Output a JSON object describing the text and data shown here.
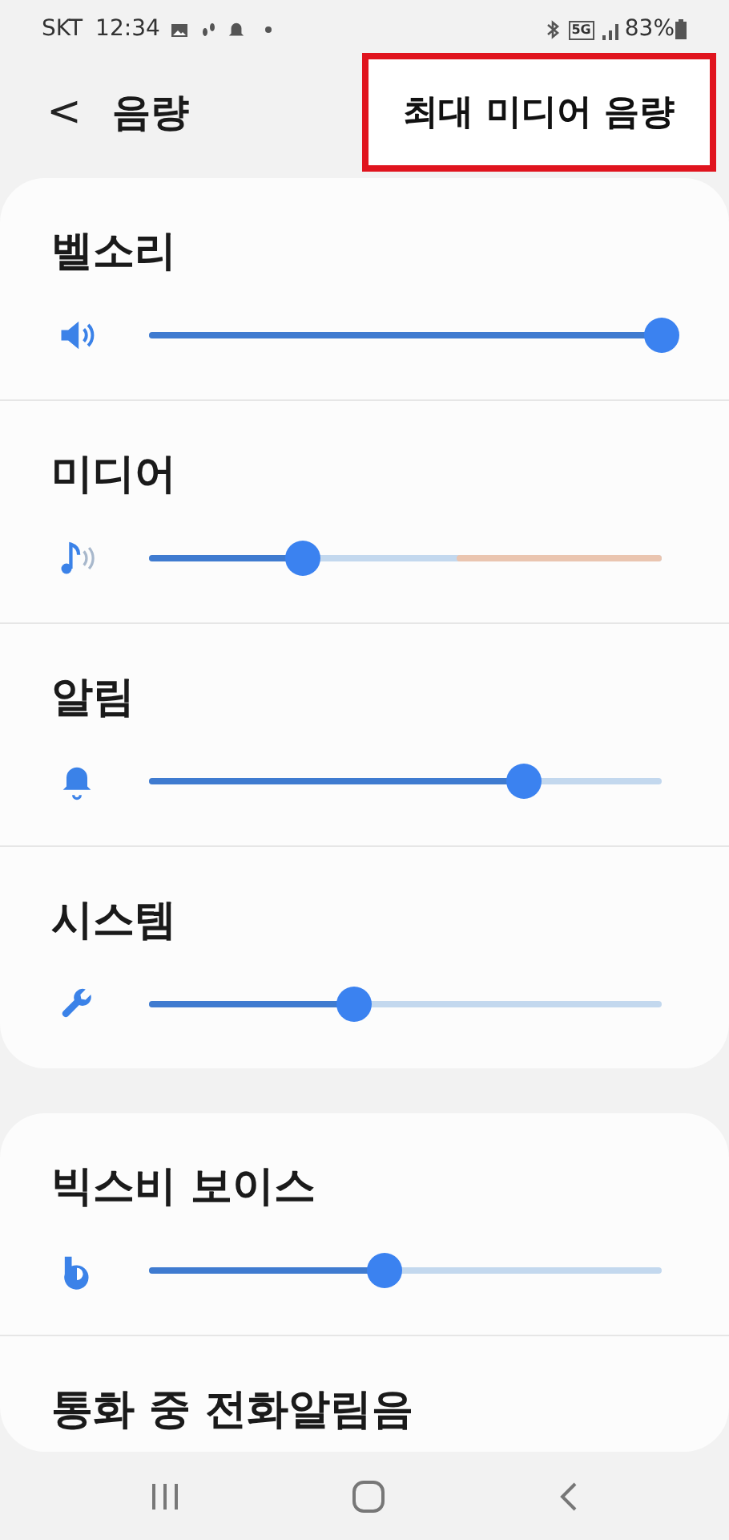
{
  "status_bar": {
    "carrier": "SKT",
    "time": "12:34",
    "network": "5G",
    "battery": "83%"
  },
  "header": {
    "back": "<",
    "title": "음량",
    "action": {
      "label": "최대 미디어 음량",
      "highlighted": true
    }
  },
  "cards": [
    {
      "items": [
        {
          "kind": "slider",
          "label": "벨소리",
          "level": 1.0
        },
        {
          "kind": "limited",
          "label": "미디어",
          "level": 0.3
        },
        {
          "kind": "slider",
          "label": "알림",
          "level": 0.73
        },
        {
          "kind": "slider",
          "label": "시스템",
          "level": 0.4
        }
      ]
    },
    {
      "items": [
        {
          "kind": "slider",
          "label": "빅스비 보이스",
          "level": 0.46
        },
        {
          "kind": "title",
          "label": "통화 중 전화알림음"
        }
      ]
    }
  ]
}
